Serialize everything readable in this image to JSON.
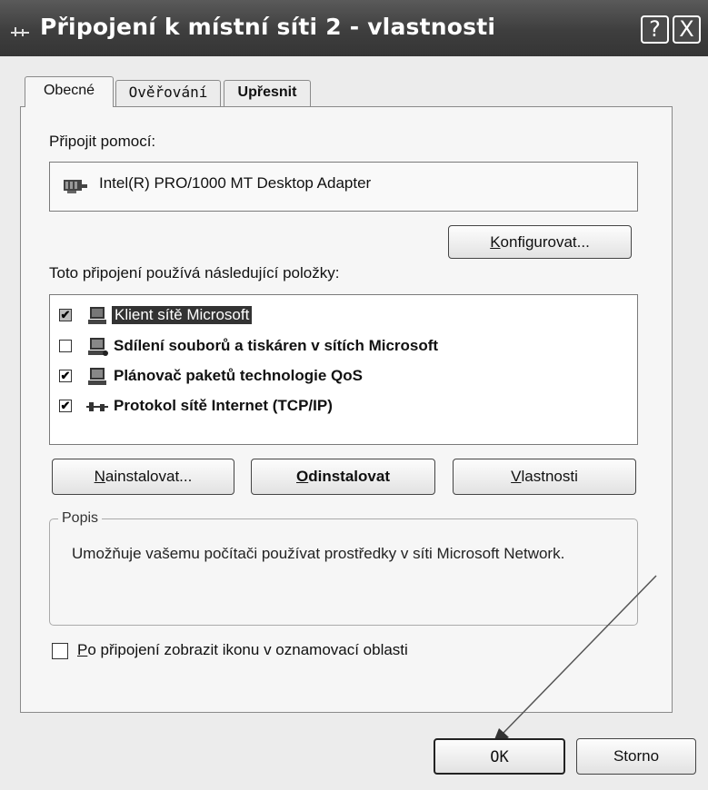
{
  "window": {
    "title": "Připojení k místní síti 2 - vlastnosti",
    "help_glyph": "?",
    "close_glyph": "X"
  },
  "tabs": [
    {
      "label": "Obecné",
      "active": true
    },
    {
      "label": "Ověřování",
      "active": false
    },
    {
      "label": "Upřesnit",
      "active": false
    }
  ],
  "general": {
    "connect_using_label": "Připojit pomocí:",
    "adapter_name": "Intel(R) PRO/1000 MT Desktop Adapter",
    "configure_button": {
      "pre": "",
      "key": "K",
      "post": "onfigurovat..."
    },
    "items_label": {
      "pre": "Toto připo",
      "key": "j",
      "post": "ení používá následující položky:"
    },
    "items": [
      {
        "label": "Klient sítě Microsoft",
        "checked": true,
        "selected": true,
        "icon": "network-client-icon"
      },
      {
        "label": "Sdílení souborů a tiskáren v sítích Microsoft",
        "checked": false,
        "selected": false,
        "icon": "file-printer-sharing-icon"
      },
      {
        "label": "Plánovač paketů technologie QoS",
        "checked": true,
        "selected": false,
        "icon": "packet-scheduler-icon"
      },
      {
        "label": "Protokol sítě Internet (TCP/IP)",
        "checked": true,
        "selected": false,
        "icon": "protocol-icon"
      }
    ],
    "install_button": {
      "pre": "",
      "key": "N",
      "post": "ainstalovat..."
    },
    "uninstall_button": {
      "pre": "",
      "key": "O",
      "post": "dinstalovat"
    },
    "properties_button": {
      "pre": "",
      "key": "V",
      "post": "lastnosti"
    },
    "description_group_title": "Popis",
    "description_text": "Umožňuje vašemu počítači používat prostředky v síti Microsoft Network.",
    "show_icon_checkbox": {
      "pre": "",
      "key": "P",
      "post": "o připojení zobrazit ikonu v oznamovací oblasti",
      "checked": false
    }
  },
  "footer": {
    "ok_button": "OK",
    "cancel_button": "Storno"
  },
  "colors": {
    "titlebar": "#3e3e3e",
    "selection": "#333333"
  }
}
